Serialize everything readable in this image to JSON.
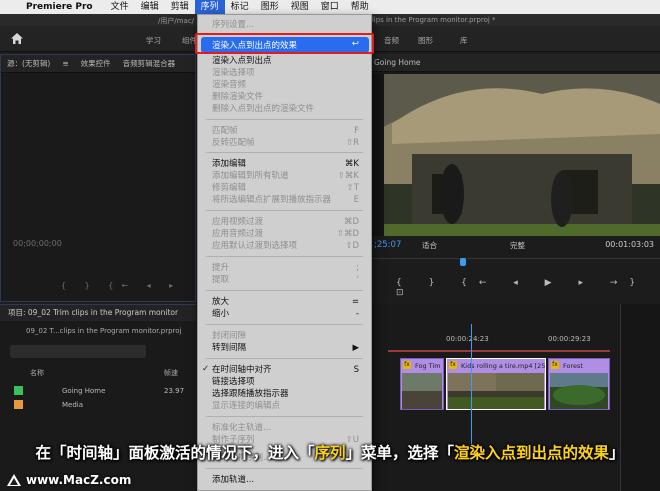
{
  "menubar": {
    "app": "Premiere Pro",
    "items": [
      "文件",
      "编辑",
      "剪辑",
      "序列",
      "标记",
      "图形",
      "视图",
      "窗口",
      "帮助"
    ],
    "active_index": 3
  },
  "titlebar": {
    "path_left": "/用户/mac/",
    "path_right": "clips in the Program monitor.prproj *"
  },
  "workspaces": [
    "学习",
    "组件",
    "编辑",
    "颜色",
    "效果",
    "音频",
    "图形",
    "库"
  ],
  "source_panel": {
    "tabs": [
      "源：(无剪辑)",
      "≡",
      "效果控件",
      "音频剪辑混合器"
    ],
    "timecode": "00;00;00;00",
    "controls": "{ } {← ◂ ▸"
  },
  "program_panel": {
    "tab": "Going Home",
    "timecode": ";25:07",
    "fit": "适合",
    "quality": "完整",
    "duration": "00:01:03:03",
    "buttons": "{ } {← ◂ ▶ ▸ →} ⊡"
  },
  "project_panel": {
    "tab": "项目: 09_02 Trim clips in the Program monitor",
    "file": "09_02 T...clips in the Program monitor.prproj",
    "col_name": "名称",
    "col_rate": "帧速",
    "rows": [
      {
        "name": "Going Home",
        "rate": "23.97",
        "color": "#3bbf5a"
      },
      {
        "name": "Media",
        "rate": "",
        "color": "#e69a3a"
      }
    ]
  },
  "timeline": {
    "time1": "00:00:24:23",
    "time2": "00:00:29:23",
    "clips": [
      "Fog Tim",
      "Kids rolling a tire.mp4 [25%]",
      "Forest"
    ]
  },
  "menu": {
    "highlighted": {
      "label": "渲染入点到出点的效果",
      "shortcut": "↩"
    },
    "items": [
      {
        "label": "序列设置...",
        "shortcut": "",
        "enabled": false
      },
      {
        "label": "渲染入点到出点",
        "shortcut": "",
        "enabled": true
      },
      {
        "label": "渲染选择项",
        "shortcut": "",
        "enabled": false
      },
      {
        "label": "渲染音频",
        "shortcut": "",
        "enabled": false
      },
      {
        "label": "删除渲染文件",
        "shortcut": "",
        "enabled": false
      },
      {
        "label": "删除入点到出点的渲染文件",
        "shortcut": "",
        "enabled": false
      },
      {
        "label": "匹配帧",
        "shortcut": "F",
        "enabled": false
      },
      {
        "label": "反转匹配帧",
        "shortcut": "⇧R",
        "enabled": false
      },
      {
        "label": "添加编辑",
        "shortcut": "⌘K",
        "enabled": true
      },
      {
        "label": "添加编辑到所有轨道",
        "shortcut": "⇧⌘K",
        "enabled": false
      },
      {
        "label": "修剪编辑",
        "shortcut": "⇧T",
        "enabled": false
      },
      {
        "label": "将所选编辑点扩展到播放指示器",
        "shortcut": "E",
        "enabled": false
      },
      {
        "label": "应用视频过渡",
        "shortcut": "⌘D",
        "enabled": false
      },
      {
        "label": "应用音频过渡",
        "shortcut": "⇧⌘D",
        "enabled": false
      },
      {
        "label": "应用默认过渡到选择项",
        "shortcut": "⇧D",
        "enabled": false
      },
      {
        "label": "提升",
        "shortcut": ";",
        "enabled": false
      },
      {
        "label": "提取",
        "shortcut": "'",
        "enabled": false
      },
      {
        "label": "放大",
        "shortcut": "=",
        "enabled": true
      },
      {
        "label": "缩小",
        "shortcut": "-",
        "enabled": true
      },
      {
        "label": "封闭间隙",
        "shortcut": "",
        "enabled": false
      },
      {
        "label": "转到间隔",
        "shortcut": "▶",
        "enabled": true
      },
      {
        "label": "在时间轴中对齐",
        "shortcut": "S",
        "enabled": true,
        "check": "✓"
      },
      {
        "label": "链接选择项",
        "shortcut": "",
        "enabled": true
      },
      {
        "label": "选择跟随播放指示器",
        "shortcut": "",
        "enabled": true
      },
      {
        "label": "显示连接的编辑点",
        "shortcut": "",
        "enabled": false
      },
      {
        "label": "标准化主轨道...",
        "shortcut": "",
        "enabled": false
      },
      {
        "label": "制作子序列",
        "shortcut": "⇧U",
        "enabled": false
      },
      {
        "label": "自动重构序列...",
        "shortcut": "",
        "enabled": false
      },
      {
        "label": "添加轨道...",
        "shortcut": "",
        "enabled": true
      }
    ]
  },
  "caption": {
    "part1": "在「时间轴」面板激活的情况下，进入「",
    "part2": "序列",
    "part3": "」菜单，选择「",
    "part4": "渲染入点到出点的效果",
    "part5": "」"
  },
  "watermark": "www.MacZ.com"
}
